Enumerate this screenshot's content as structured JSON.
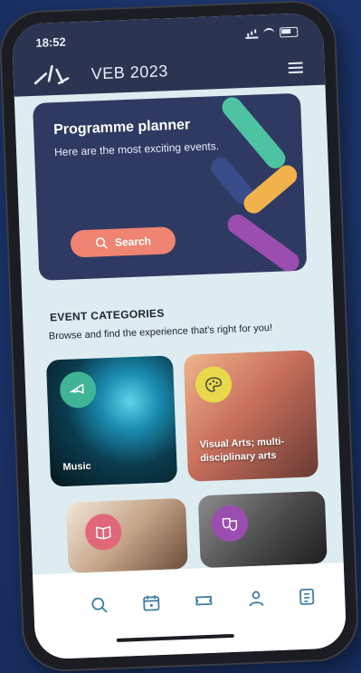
{
  "status": {
    "time": "18:52"
  },
  "header": {
    "brand": "VEB 2023"
  },
  "hero": {
    "title": "Programme planner",
    "subtitle": "Here are the most exciting events.",
    "search_label": "Search"
  },
  "categories": {
    "title": "EVENT CATEGORIES",
    "subtitle": "Browse and find the experience that's right for you!",
    "items": [
      {
        "label": "Music",
        "icon": "trumpet-icon"
      },
      {
        "label": "Visual Arts; multi-disciplinary arts",
        "icon": "palette-icon"
      },
      {
        "label": "",
        "icon": "book-icon"
      },
      {
        "label": "",
        "icon": "theatre-masks-icon"
      }
    ]
  },
  "tabbar": {
    "items": [
      "search-icon",
      "calendar-icon",
      "ticket-icon",
      "profile-icon",
      "document-icon"
    ]
  },
  "colors": {
    "header_bg": "#2b3552",
    "hero_bg": "#2f3a63",
    "accent": "#ef8472",
    "screen_bg": "#dcecf0",
    "tab_icon": "#3f7fa0"
  }
}
